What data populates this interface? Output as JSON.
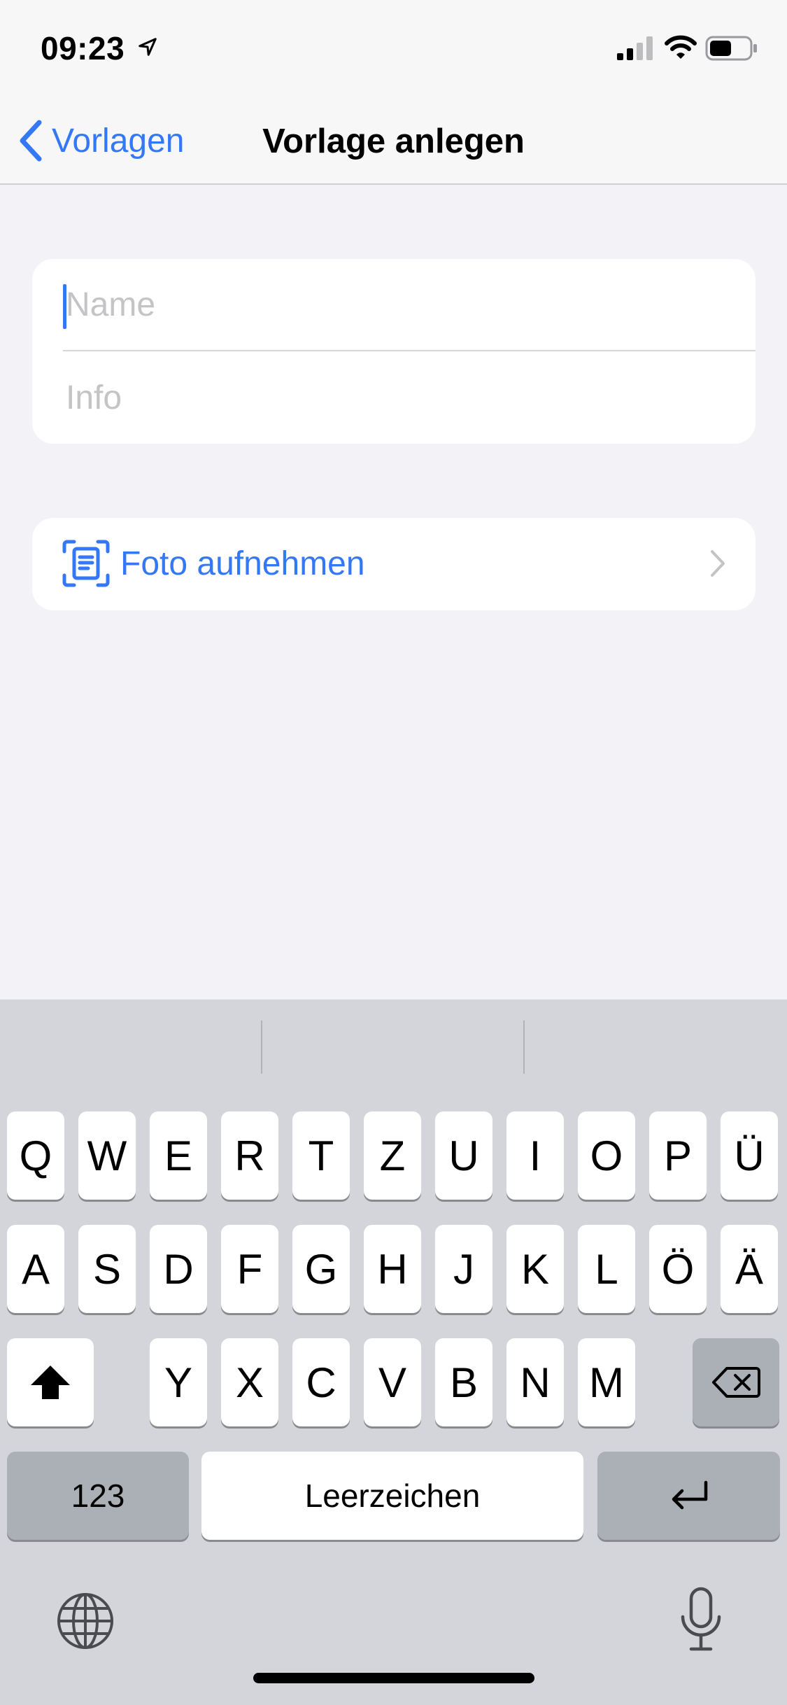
{
  "status_bar": {
    "time": "09:23",
    "icons": [
      "location-arrow-icon",
      "cellular-signal-icon",
      "wifi-icon",
      "battery-icon"
    ]
  },
  "nav": {
    "back_label": "Vorlagen",
    "title": "Vorlage anlegen"
  },
  "form": {
    "name_placeholder": "Name",
    "name_value": "",
    "info_placeholder": "Info",
    "info_value": ""
  },
  "photo_row": {
    "label": "Foto aufnehmen",
    "icon": "document-scan-icon"
  },
  "keyboard": {
    "row1": [
      "Q",
      "W",
      "E",
      "R",
      "T",
      "Z",
      "U",
      "I",
      "O",
      "P",
      "Ü"
    ],
    "row2": [
      "A",
      "S",
      "D",
      "F",
      "G",
      "H",
      "J",
      "K",
      "L",
      "Ö",
      "Ä"
    ],
    "row3": [
      "Y",
      "X",
      "C",
      "V",
      "B",
      "N",
      "M"
    ],
    "numbers_key": "123",
    "space_key": "Leerzeichen"
  },
  "colors": {
    "accent": "#3478f6",
    "background": "#f2f2f7",
    "keyboard_bg": "#d3d5da",
    "special_key": "#abafb6"
  }
}
